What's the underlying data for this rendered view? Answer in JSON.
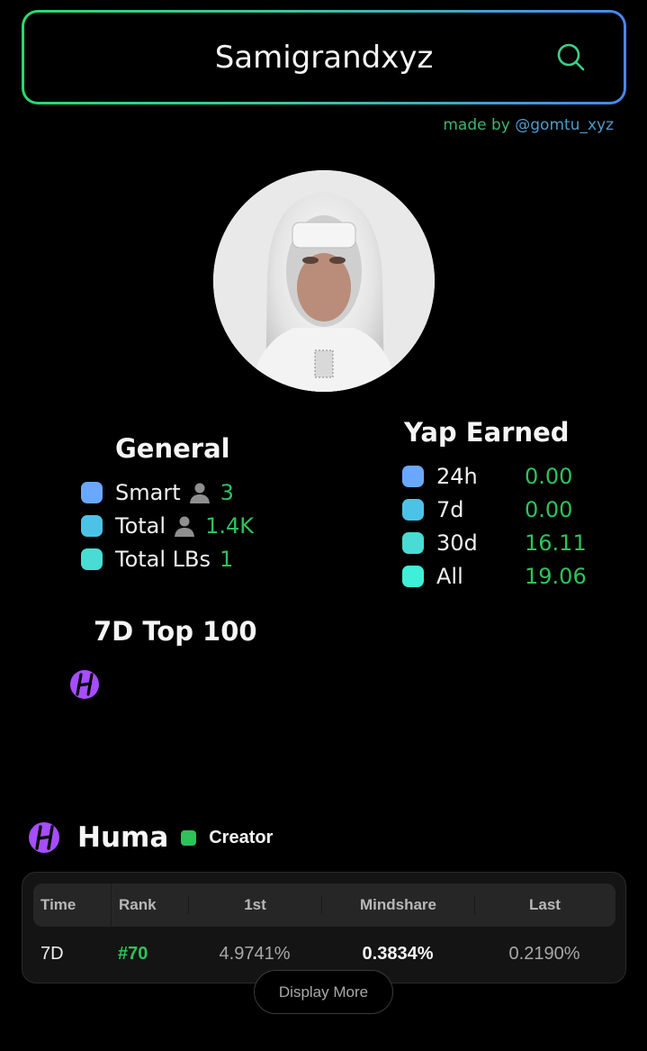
{
  "search": {
    "value": "Samigrandxyz"
  },
  "credit": {
    "prefix": "made by ",
    "handle": "@gomtu_xyz"
  },
  "colors": {
    "accent_green": "#2ec25a",
    "border_gradient_start": "#2bd96b",
    "border_gradient_end": "#4a86f0",
    "dot_1": "#6aa8ff",
    "dot_2": "#4cc3e6",
    "dot_3": "#48dcd4",
    "dot_4": "#3ef0d8",
    "huma_purple": "#a64dff"
  },
  "general": {
    "title": "General",
    "items": [
      {
        "label": "Smart",
        "value": "3",
        "icon": "person-icon"
      },
      {
        "label": "Total",
        "value": "1.4K",
        "icon": "person-icon"
      },
      {
        "label": "Total LBs",
        "value": "1"
      }
    ]
  },
  "yap": {
    "title": "Yap Earned",
    "items": [
      {
        "label": "24h",
        "value": "0.00"
      },
      {
        "label": "7d",
        "value": "0.00"
      },
      {
        "label": "30d",
        "value": "16.11"
      },
      {
        "label": "All",
        "value": "19.06"
      }
    ]
  },
  "top100": {
    "title": "7D Top 100",
    "icons": [
      "huma-logo-icon"
    ]
  },
  "project": {
    "name": "Huma",
    "role": "Creator",
    "table": {
      "headers": [
        "Time",
        "Rank",
        "1st",
        "Mindshare",
        "Last"
      ],
      "rows": [
        {
          "time": "7D",
          "rank": "#70",
          "first": "4.9741%",
          "mindshare": "0.3834%",
          "last": "0.2190%"
        }
      ]
    },
    "more_label": "Display More"
  }
}
